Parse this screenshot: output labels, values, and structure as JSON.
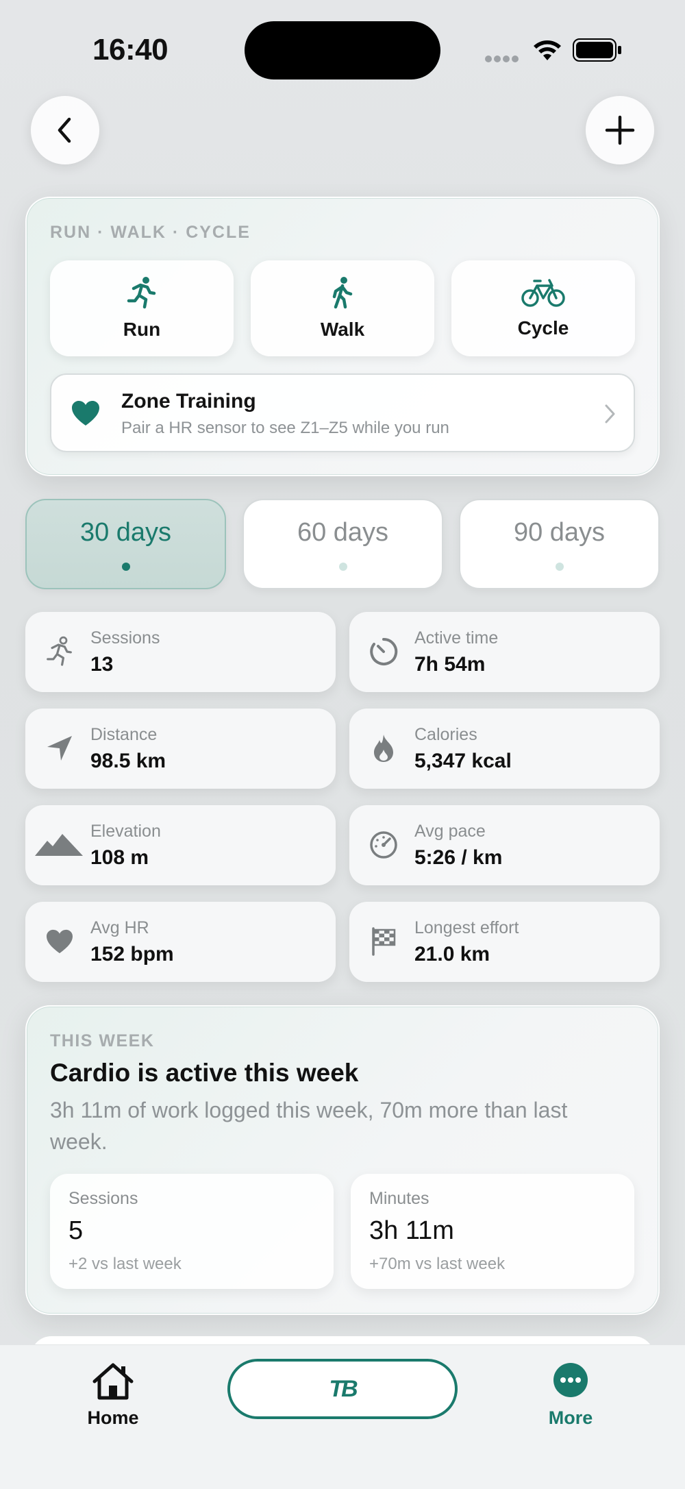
{
  "status_bar": {
    "time": "16:40"
  },
  "header": {
    "back_icon": "chevron-left-icon",
    "add_icon": "plus-icon"
  },
  "modes_card": {
    "eyebrow": "RUN · WALK · CYCLE",
    "modes": [
      {
        "label": "Run",
        "icon": "run-icon"
      },
      {
        "label": "Walk",
        "icon": "walk-icon"
      },
      {
        "label": "Cycle",
        "icon": "bike-icon"
      }
    ],
    "zone": {
      "title": "Zone Training",
      "subtitle": "Pair a HR sensor to see Z1–Z5 while you run",
      "icon": "heart-icon"
    },
    "accent": "#1a7a6c"
  },
  "ranges": [
    {
      "label": "30 days",
      "active": true
    },
    {
      "label": "60 days",
      "active": false
    },
    {
      "label": "90 days",
      "active": false
    }
  ],
  "stats": [
    {
      "label": "Sessions",
      "value": "13",
      "icon": "run-icon"
    },
    {
      "label": "Active time",
      "value": "7h 54m",
      "icon": "timer-icon"
    },
    {
      "label": "Distance",
      "value": "98.5 km",
      "icon": "location-arrow-icon"
    },
    {
      "label": "Calories",
      "value": "5,347 kcal",
      "icon": "flame-icon"
    },
    {
      "label": "Elevation",
      "value": "108 m",
      "icon": "mountain-icon"
    },
    {
      "label": "Avg pace",
      "value": "5:26 / km",
      "icon": "speedometer-icon"
    },
    {
      "label": "Avg HR",
      "value": "152 bpm",
      "icon": "heart-icon"
    },
    {
      "label": "Longest effort",
      "value": "21.0 km",
      "icon": "flag-icon"
    }
  ],
  "this_week": {
    "eyebrow": "THIS WEEK",
    "title": "Cardio is active this week",
    "subtitle": "3h 11m of work logged this week, 70m more than last week.",
    "cards": [
      {
        "label": "Sessions",
        "value": "5",
        "delta": "+2 vs last week"
      },
      {
        "label": "Minutes",
        "value": "3h 11m",
        "delta": "+70m vs last week"
      }
    ]
  },
  "tab_bar": {
    "home_label": "Home",
    "center_label": "TB",
    "more_label": "More",
    "active": "More"
  }
}
